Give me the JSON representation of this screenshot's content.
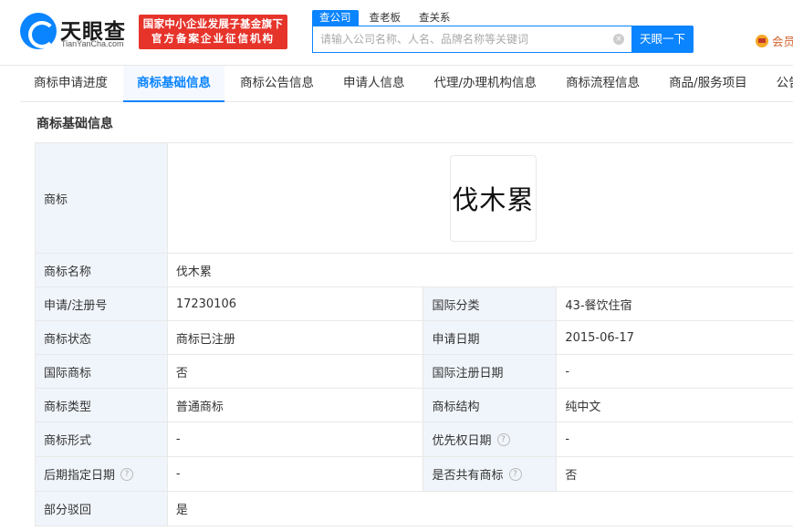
{
  "header": {
    "logo_text": "天眼查",
    "logo_sub": "TianYanCha.com",
    "badge_line1": "国家中小企业发展子基金旗下",
    "badge_line2": "官方备案企业征信机构",
    "search_tabs": [
      "查公司",
      "查老板",
      "查关系"
    ],
    "search_placeholder": "请输入公司名称、人名、品牌名称等关键词",
    "clear_glyph": "×",
    "search_button": "天眼一下",
    "vip_label": "会员"
  },
  "nav": {
    "tabs": [
      "商标申请进度",
      "商标基础信息",
      "商标公告信息",
      "申请人信息",
      "代理/办理机构信息",
      "商标流程信息",
      "商品/服务项目",
      "公告信息"
    ],
    "active_index": 1
  },
  "section": {
    "title": "商标基础信息"
  },
  "table": {
    "trademark_label": "商标",
    "trademark_image_text": "伐木累",
    "name_label": "商标名称",
    "name_value": "伐木累",
    "regno_label": "申请/注册号",
    "regno_value": "17230106",
    "intl_class_label": "国际分类",
    "intl_class_value": "43-餐饮住宿",
    "status_label": "商标状态",
    "status_value": "商标已注册",
    "apply_date_label": "申请日期",
    "apply_date_value": "2015-06-17",
    "intl_tm_label": "国际商标",
    "intl_tm_value": "否",
    "intl_reg_date_label": "国际注册日期",
    "intl_reg_date_value": "-",
    "type_label": "商标类型",
    "type_value": "普通商标",
    "structure_label": "商标结构",
    "structure_value": "纯中文",
    "form_label": "商标形式",
    "form_value": "-",
    "priority_date_label": "优先权日期",
    "priority_date_value": "-",
    "later_date_label": "后期指定日期",
    "later_date_value": "-",
    "shared_label": "是否共有商标",
    "shared_value": "否",
    "partial_reject_label": "部分驳回",
    "partial_reject_value": "是",
    "help_glyph": "?"
  }
}
